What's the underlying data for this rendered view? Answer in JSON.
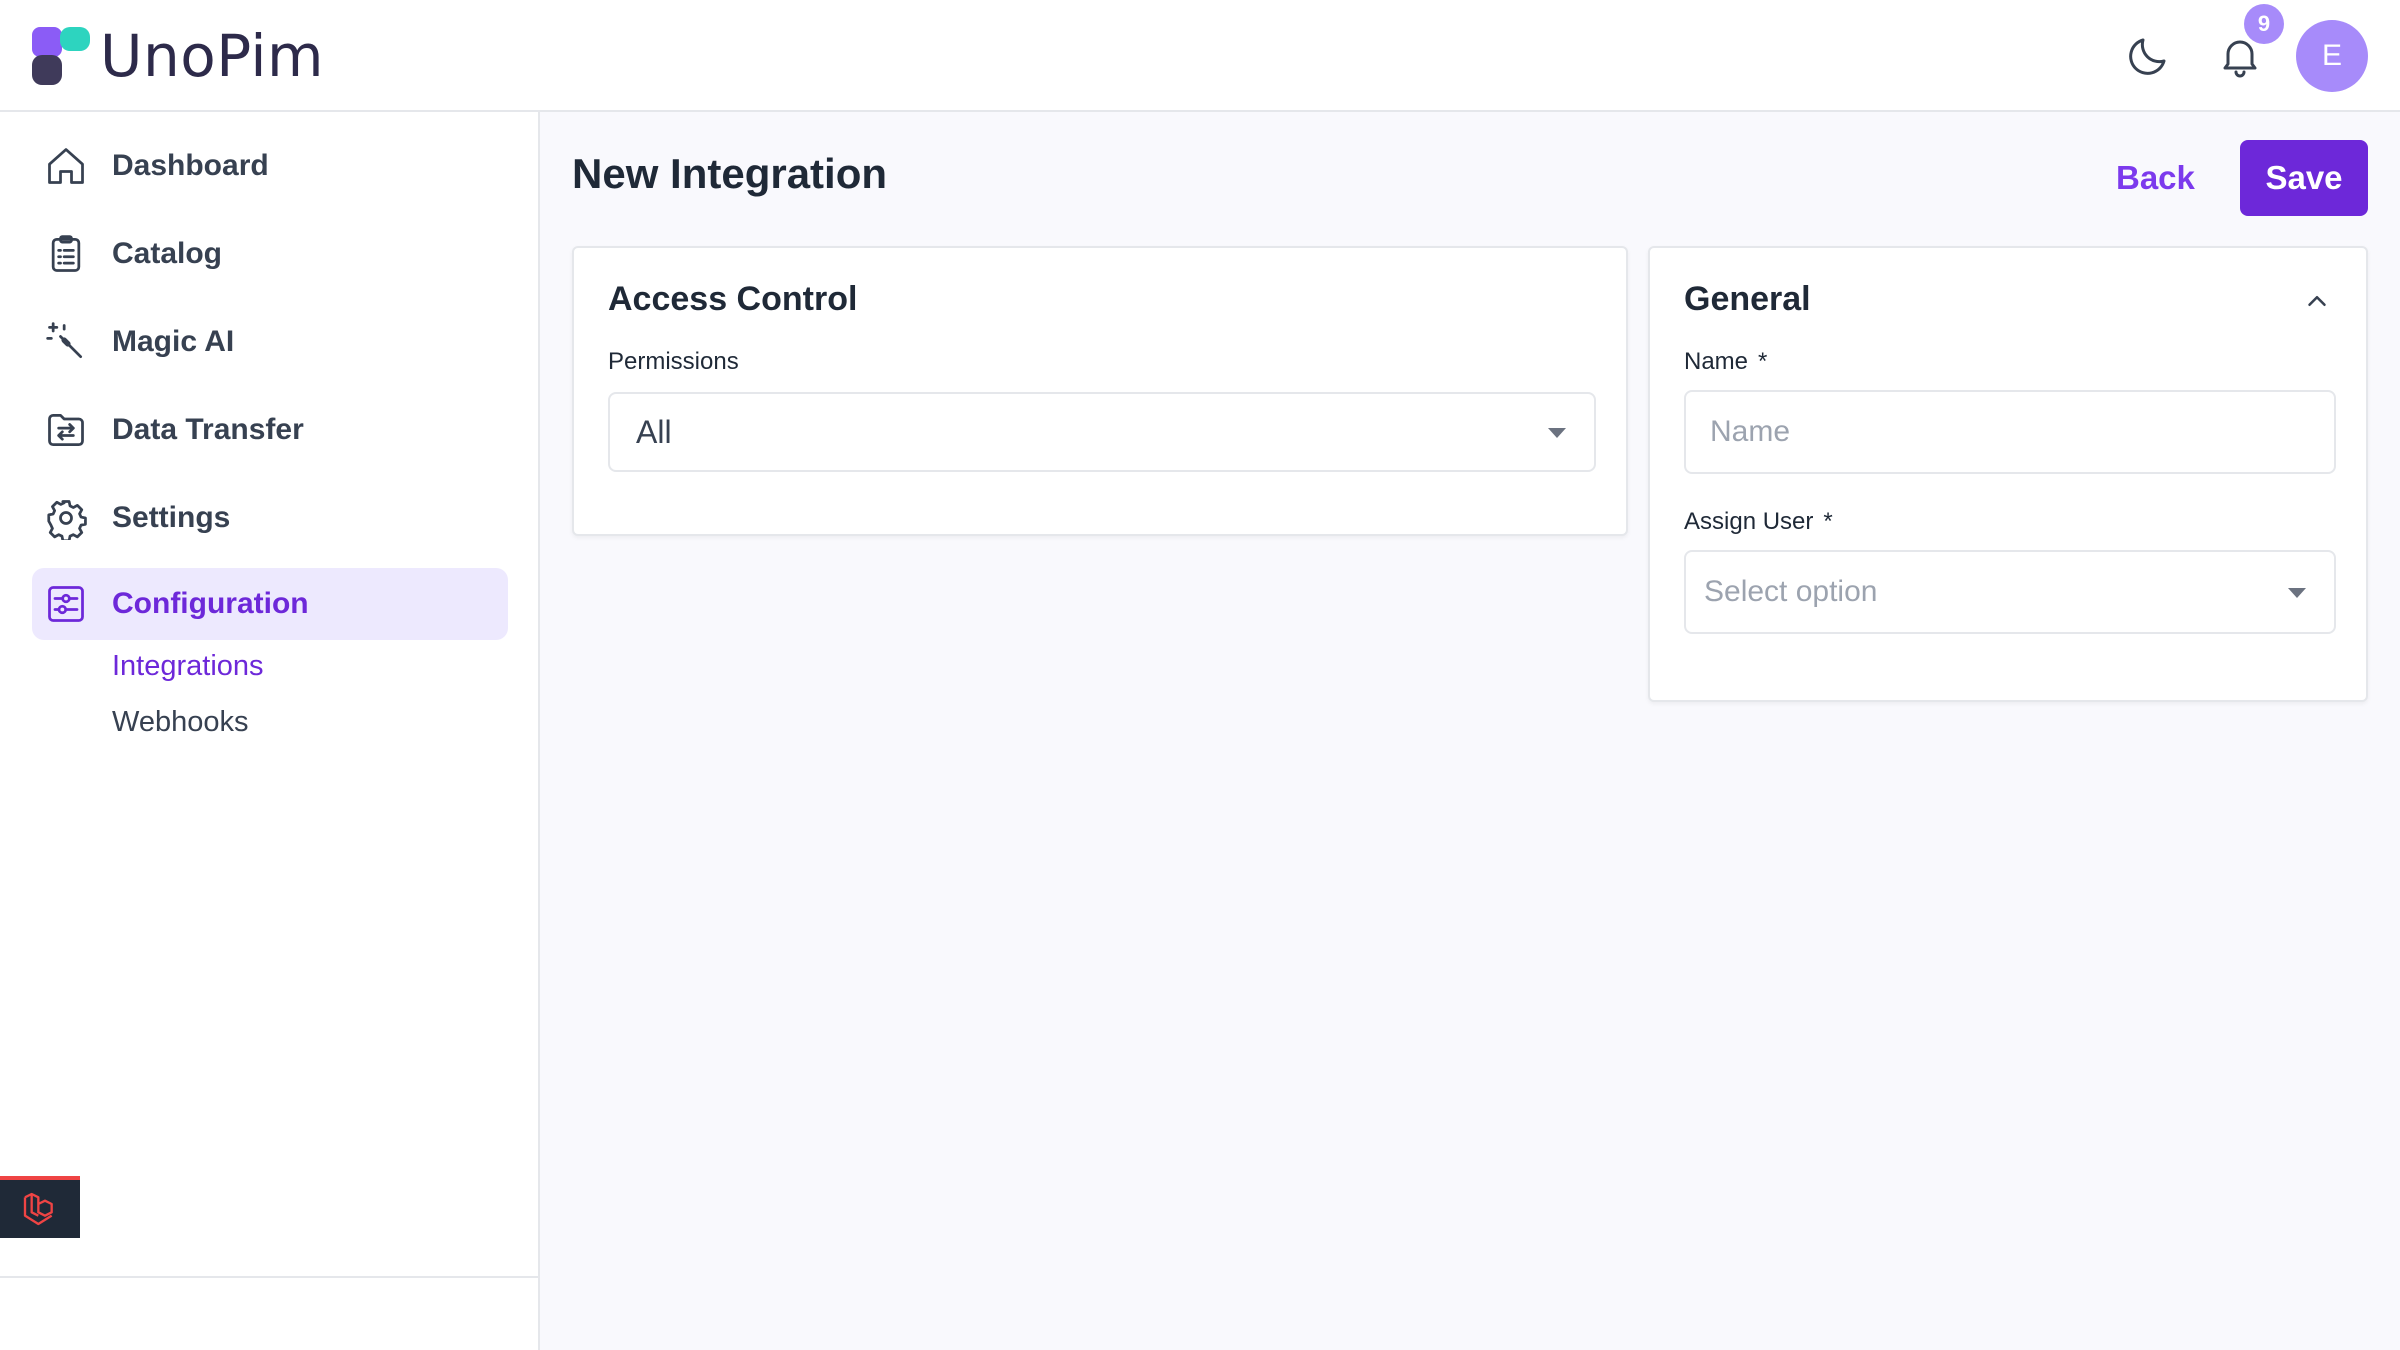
{
  "brand": {
    "name": "UnoPim"
  },
  "header": {
    "notification_count": "9",
    "avatar_initial": "E"
  },
  "sidebar": {
    "items": [
      {
        "label": "Dashboard"
      },
      {
        "label": "Catalog"
      },
      {
        "label": "Magic AI"
      },
      {
        "label": "Data Transfer"
      },
      {
        "label": "Settings"
      },
      {
        "label": "Configuration"
      }
    ],
    "sub_items": [
      {
        "label": "Integrations"
      },
      {
        "label": "Webhooks"
      }
    ]
  },
  "page": {
    "title": "New Integration",
    "back_label": "Back",
    "save_label": "Save"
  },
  "access_control": {
    "title": "Access Control",
    "permissions_label": "Permissions",
    "permissions_value": "All"
  },
  "general": {
    "title": "General",
    "name_label": "Name",
    "name_placeholder": "Name",
    "required_mark": "*",
    "assign_user_label": "Assign User",
    "assign_user_placeholder": "Select option"
  },
  "colors": {
    "accent": "#6d28d9",
    "accent_light": "#ede9fe",
    "badge": "#a78bfa"
  }
}
